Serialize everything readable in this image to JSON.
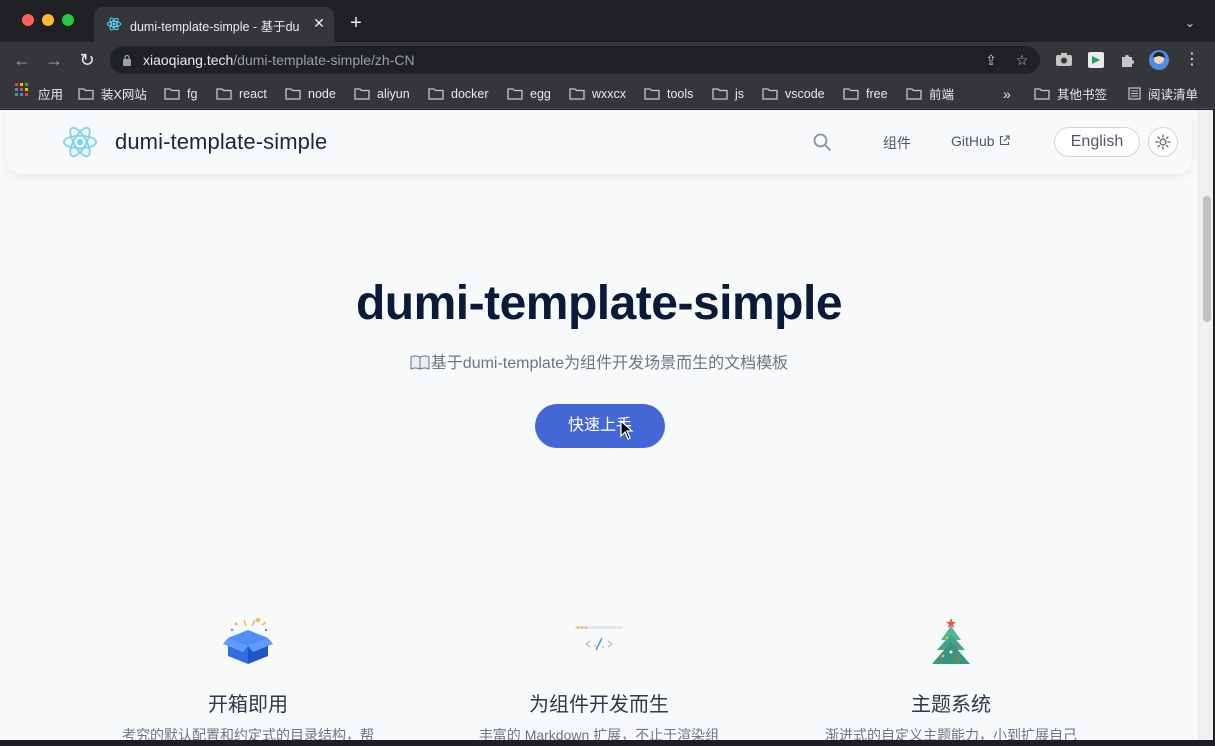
{
  "browser": {
    "tab_title": "dumi-template-simple - 基于du",
    "url_host": "xiaoqiang.tech",
    "url_path": "/dumi-template-simple/zh-CN",
    "bookmarks": [
      "应用",
      "装X网站",
      "fg",
      "react",
      "node",
      "aliyun",
      "docker",
      "egg",
      "wxxcx",
      "tools",
      "js",
      "vscode",
      "free",
      "前端"
    ],
    "bookmarks_more": "»",
    "other_bookmarks": "其他书签",
    "reading_list": "阅读清单"
  },
  "header": {
    "site_title": "dumi-template-simple",
    "nav_components": "组件",
    "nav_github": "GitHub",
    "lang_button": "English"
  },
  "hero": {
    "title": "dumi-template-simple",
    "description": "基于dumi-template为组件开发场景而生的文档模板",
    "cta_label": "快速上手"
  },
  "features": [
    {
      "title": "开箱即用",
      "description": "考究的默认配置和约定式的目录结构，帮",
      "icon": "gift-box-icon"
    },
    {
      "title": "为组件开发而生",
      "description": "丰富的 Markdown 扩展，不止于渲染组",
      "icon": "code-window-icon"
    },
    {
      "title": "主题系统",
      "description": "渐进式的自定义主题能力，小到扩展自己",
      "icon": "christmas-tree-icon"
    }
  ],
  "colors": {
    "primary": "#4467d6",
    "hero_title": "#0c1a3a",
    "page_bg": "#f8f9fa",
    "chrome_bg": "#202124"
  }
}
